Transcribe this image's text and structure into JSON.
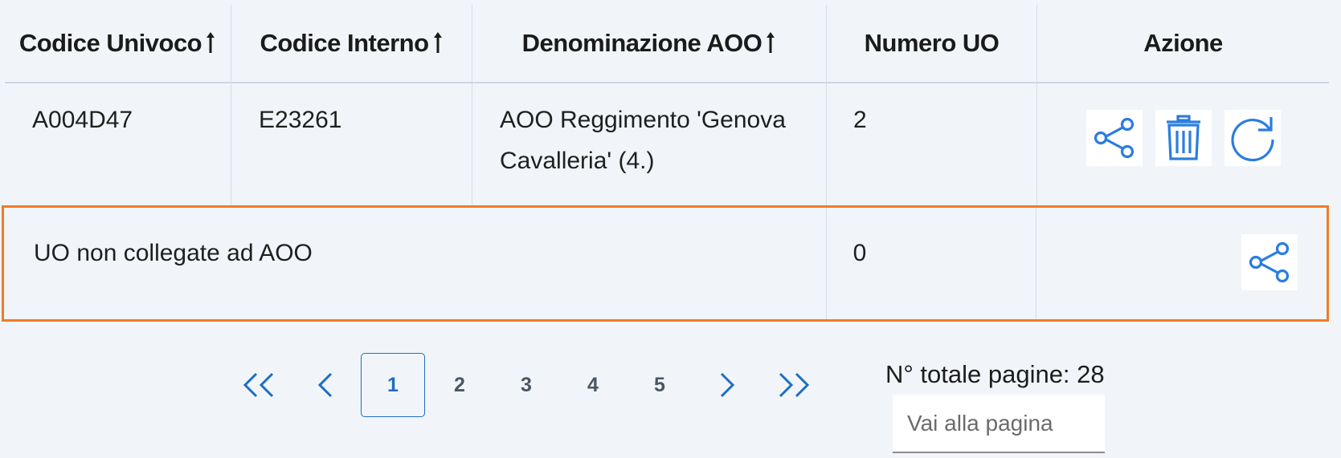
{
  "table": {
    "headers": [
      {
        "label": "Codice Univoco",
        "sortable": true
      },
      {
        "label": "Codice Interno",
        "sortable": true
      },
      {
        "label": "Denominazione AOO",
        "sortable": true
      },
      {
        "label": "Numero UO",
        "sortable": false
      },
      {
        "label": "Azione",
        "sortable": false
      }
    ],
    "rows": [
      {
        "codice_univoco": "A004D47",
        "codice_interno": "E23261",
        "denominazione_line1": "AOO Reggimento 'Genova",
        "denominazione_line2": "Cavalleria' (4.)",
        "numero_uo": "2",
        "actions": [
          "share-icon",
          "trash-icon",
          "refresh-icon"
        ]
      }
    ],
    "summary_row": {
      "label": "UO non collegate ad AOO",
      "numero_uo": "0",
      "actions": [
        "share-icon"
      ],
      "highlight_color": "#f07b28"
    }
  },
  "pagination": {
    "first_icon": "double-chevron-left-icon",
    "prev_icon": "chevron-left-icon",
    "pages": [
      "1",
      "2",
      "3",
      "4",
      "5"
    ],
    "current_page": "1",
    "next_icon": "chevron-right-icon",
    "last_icon": "double-chevron-right-icon",
    "total_pages_text": "N° totale pagine: 28",
    "goto_placeholder": "Vai alla pagina"
  },
  "colors": {
    "accent": "#1e6ec0",
    "icon_blue": "#2a7de1",
    "highlight": "#f07b28",
    "background": "#f1f5f9"
  }
}
